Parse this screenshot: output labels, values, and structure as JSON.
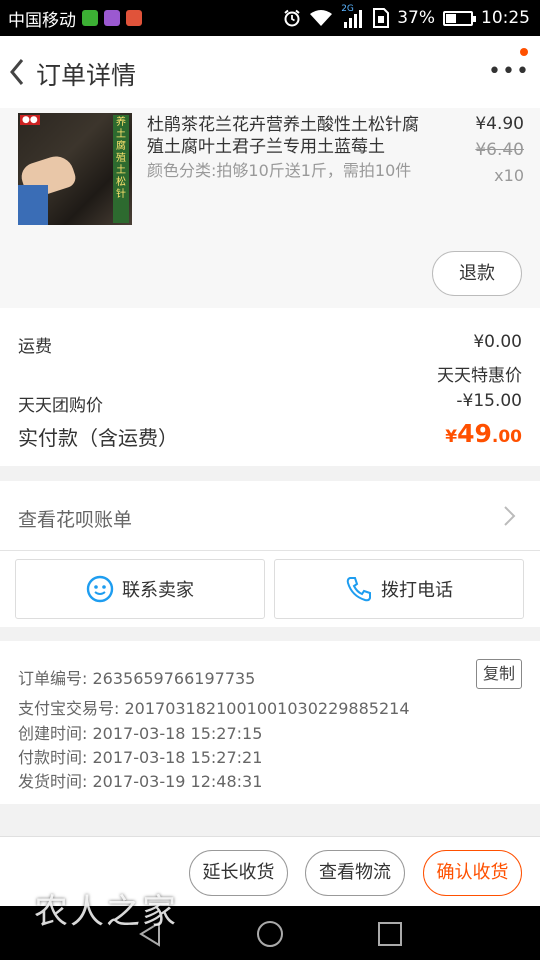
{
  "status_bar": {
    "carrier": "中国移动",
    "network": "2G",
    "battery": "37%",
    "battery_level": 0.37,
    "time": "10:25",
    "icons": [
      "wechat-icon",
      "gallery-icon",
      "app-icon",
      "alarm-icon",
      "wifi-icon",
      "signal-icon",
      "sim-icon",
      "battery-icon"
    ]
  },
  "header": {
    "title": "订单详情",
    "more": "•••"
  },
  "product": {
    "name": "杜鹃茶花兰花卉营养土酸性土松针腐殖土腐叶土君子兰专用土蓝莓土",
    "sku": "颜色分类:拍够10斤送1斤，需拍10件",
    "price": "¥4.90",
    "original_price": "¥6.40",
    "quantity": "x10",
    "refund_label": "退款",
    "image_text": "养土腐殖土松针"
  },
  "fees": {
    "shipping_label": "运费",
    "shipping_value": "¥0.00",
    "promo_name": "天天特惠价",
    "group_label": "天天团购价",
    "group_value": "-¥15.00",
    "paid_label": "实付款（含运费）",
    "paid_currency": "¥",
    "paid_int": "49",
    "paid_dec": ".00"
  },
  "huabei": {
    "label": "查看花呗账单"
  },
  "contact": {
    "seller_label": "联系卖家",
    "phone_label": "拨打电话"
  },
  "order_info": {
    "order_no": "订单编号:  2635659766197735",
    "copy_label": "复制",
    "alipay_no": "支付宝交易号:  2017031821001001030229885214",
    "created": "创建时间:  2017-03-18 15:27:15",
    "paid": "付款时间:  2017-03-18 15:27:21",
    "shipped": "发货时间:  2017-03-19 12:48:31"
  },
  "actions": {
    "extend_label": "延长收货",
    "logistics_label": "查看物流",
    "confirm_label": "确认收货"
  },
  "colors": {
    "accent": "#ff5000",
    "contact_icon": "#1e9df0"
  },
  "watermark": "农人之家"
}
